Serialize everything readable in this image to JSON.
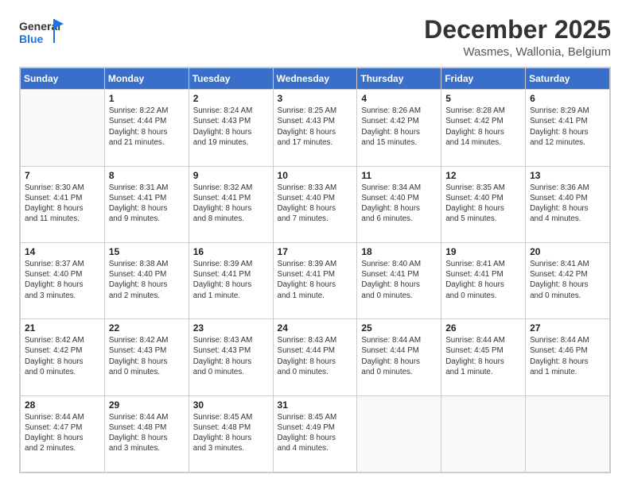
{
  "header": {
    "logo_general": "General",
    "logo_blue": "Blue",
    "title": "December 2025",
    "subtitle": "Wasmes, Wallonia, Belgium"
  },
  "days_of_week": [
    "Sunday",
    "Monday",
    "Tuesday",
    "Wednesday",
    "Thursday",
    "Friday",
    "Saturday"
  ],
  "weeks": [
    [
      {
        "day": "",
        "info": ""
      },
      {
        "day": "1",
        "info": "Sunrise: 8:22 AM\nSunset: 4:44 PM\nDaylight: 8 hours\nand 21 minutes."
      },
      {
        "day": "2",
        "info": "Sunrise: 8:24 AM\nSunset: 4:43 PM\nDaylight: 8 hours\nand 19 minutes."
      },
      {
        "day": "3",
        "info": "Sunrise: 8:25 AM\nSunset: 4:43 PM\nDaylight: 8 hours\nand 17 minutes."
      },
      {
        "day": "4",
        "info": "Sunrise: 8:26 AM\nSunset: 4:42 PM\nDaylight: 8 hours\nand 15 minutes."
      },
      {
        "day": "5",
        "info": "Sunrise: 8:28 AM\nSunset: 4:42 PM\nDaylight: 8 hours\nand 14 minutes."
      },
      {
        "day": "6",
        "info": "Sunrise: 8:29 AM\nSunset: 4:41 PM\nDaylight: 8 hours\nand 12 minutes."
      }
    ],
    [
      {
        "day": "7",
        "info": "Sunrise: 8:30 AM\nSunset: 4:41 PM\nDaylight: 8 hours\nand 11 minutes."
      },
      {
        "day": "8",
        "info": "Sunrise: 8:31 AM\nSunset: 4:41 PM\nDaylight: 8 hours\nand 9 minutes."
      },
      {
        "day": "9",
        "info": "Sunrise: 8:32 AM\nSunset: 4:41 PM\nDaylight: 8 hours\nand 8 minutes."
      },
      {
        "day": "10",
        "info": "Sunrise: 8:33 AM\nSunset: 4:40 PM\nDaylight: 8 hours\nand 7 minutes."
      },
      {
        "day": "11",
        "info": "Sunrise: 8:34 AM\nSunset: 4:40 PM\nDaylight: 8 hours\nand 6 minutes."
      },
      {
        "day": "12",
        "info": "Sunrise: 8:35 AM\nSunset: 4:40 PM\nDaylight: 8 hours\nand 5 minutes."
      },
      {
        "day": "13",
        "info": "Sunrise: 8:36 AM\nSunset: 4:40 PM\nDaylight: 8 hours\nand 4 minutes."
      }
    ],
    [
      {
        "day": "14",
        "info": "Sunrise: 8:37 AM\nSunset: 4:40 PM\nDaylight: 8 hours\nand 3 minutes."
      },
      {
        "day": "15",
        "info": "Sunrise: 8:38 AM\nSunset: 4:40 PM\nDaylight: 8 hours\nand 2 minutes."
      },
      {
        "day": "16",
        "info": "Sunrise: 8:39 AM\nSunset: 4:41 PM\nDaylight: 8 hours\nand 1 minute."
      },
      {
        "day": "17",
        "info": "Sunrise: 8:39 AM\nSunset: 4:41 PM\nDaylight: 8 hours\nand 1 minute."
      },
      {
        "day": "18",
        "info": "Sunrise: 8:40 AM\nSunset: 4:41 PM\nDaylight: 8 hours\nand 0 minutes."
      },
      {
        "day": "19",
        "info": "Sunrise: 8:41 AM\nSunset: 4:41 PM\nDaylight: 8 hours\nand 0 minutes."
      },
      {
        "day": "20",
        "info": "Sunrise: 8:41 AM\nSunset: 4:42 PM\nDaylight: 8 hours\nand 0 minutes."
      }
    ],
    [
      {
        "day": "21",
        "info": "Sunrise: 8:42 AM\nSunset: 4:42 PM\nDaylight: 8 hours\nand 0 minutes."
      },
      {
        "day": "22",
        "info": "Sunrise: 8:42 AM\nSunset: 4:43 PM\nDaylight: 8 hours\nand 0 minutes."
      },
      {
        "day": "23",
        "info": "Sunrise: 8:43 AM\nSunset: 4:43 PM\nDaylight: 8 hours\nand 0 minutes."
      },
      {
        "day": "24",
        "info": "Sunrise: 8:43 AM\nSunset: 4:44 PM\nDaylight: 8 hours\nand 0 minutes."
      },
      {
        "day": "25",
        "info": "Sunrise: 8:44 AM\nSunset: 4:44 PM\nDaylight: 8 hours\nand 0 minutes."
      },
      {
        "day": "26",
        "info": "Sunrise: 8:44 AM\nSunset: 4:45 PM\nDaylight: 8 hours\nand 1 minute."
      },
      {
        "day": "27",
        "info": "Sunrise: 8:44 AM\nSunset: 4:46 PM\nDaylight: 8 hours\nand 1 minute."
      }
    ],
    [
      {
        "day": "28",
        "info": "Sunrise: 8:44 AM\nSunset: 4:47 PM\nDaylight: 8 hours\nand 2 minutes."
      },
      {
        "day": "29",
        "info": "Sunrise: 8:44 AM\nSunset: 4:48 PM\nDaylight: 8 hours\nand 3 minutes."
      },
      {
        "day": "30",
        "info": "Sunrise: 8:45 AM\nSunset: 4:48 PM\nDaylight: 8 hours\nand 3 minutes."
      },
      {
        "day": "31",
        "info": "Sunrise: 8:45 AM\nSunset: 4:49 PM\nDaylight: 8 hours\nand 4 minutes."
      },
      {
        "day": "",
        "info": ""
      },
      {
        "day": "",
        "info": ""
      },
      {
        "day": "",
        "info": ""
      }
    ]
  ]
}
